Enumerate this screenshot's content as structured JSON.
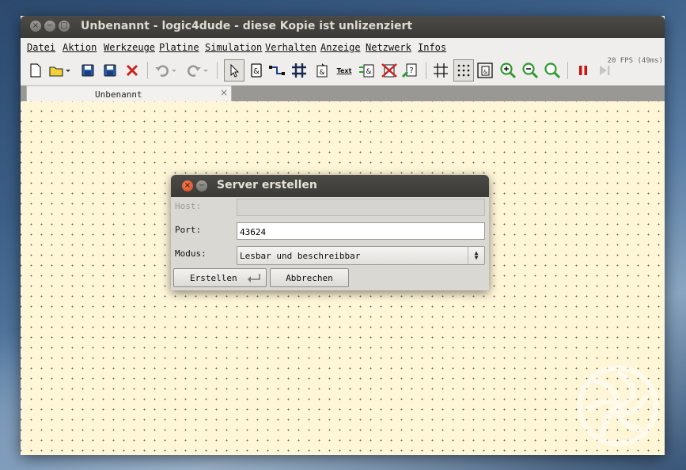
{
  "window": {
    "title": "Unbenannt - logic4dude - diese Kopie ist unlizenziert"
  },
  "menu": [
    "Datei",
    "Aktion",
    "Werkzeuge",
    "Platine",
    "Simulation",
    "Verhalten",
    "Anzeige",
    "Netzwerk",
    "Infos"
  ],
  "toolbar": {
    "fps": "20 FPS (49ms)",
    "text_tool_label": "Text",
    "icons": [
      "new-file-icon",
      "open-folder-icon",
      "save-icon",
      "save-as-icon",
      "delete-icon",
      "undo-icon",
      "redo-icon",
      "select-pointer-icon",
      "and-gate-icon",
      "wire-icon",
      "bus-icon",
      "component-icon",
      "text-icon",
      "chip-icon",
      "remove-chip-icon",
      "probe-icon",
      "grid-icon",
      "dot-grid-icon",
      "fit-icon",
      "zoom-in-icon",
      "zoom-out-icon",
      "zoom-reset-icon",
      "pause-icon",
      "step-icon"
    ],
    "accent_colors": {
      "pause": "#cc1111",
      "delete": "#cc2222",
      "save": "#2a5db0",
      "zoom": "#2f9a2f"
    }
  },
  "tab": {
    "label": "Unbenannt",
    "close": "×"
  },
  "dialog": {
    "title": "Server erstellen",
    "host_label": "Host:",
    "host_value": "",
    "port_label": "Port:",
    "port_value": "43624",
    "mode_label": "Modus:",
    "mode_value": "Lesbar und beschreibbar",
    "create_button": "Erstellen",
    "cancel_button": "Abbrechen"
  },
  "canvas": {
    "background": "#fff6d8"
  }
}
